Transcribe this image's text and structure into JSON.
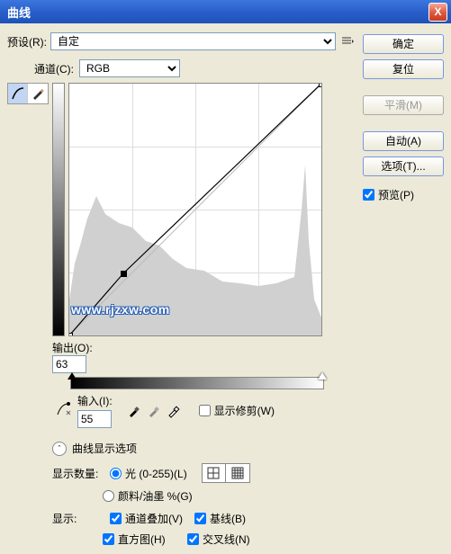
{
  "title": "曲线",
  "close": "X",
  "preset": {
    "label": "预设(R):",
    "value": "自定"
  },
  "channel": {
    "label": "通道(C):",
    "value": "RGB"
  },
  "output": {
    "label": "输出(O):",
    "value": "63"
  },
  "input": {
    "label": "输入(I):",
    "value": "55"
  },
  "showClip": "显示修剪(W)",
  "displayOptions": "曲线显示选项",
  "displayCount": {
    "label": "显示数量:",
    "opt1": "光 (0-255)(L)",
    "opt2": "颜料/油墨 %(G)"
  },
  "show": {
    "label": "显示:",
    "chOverlay": "通道叠加(V)",
    "baseline": "基线(B)",
    "histogram": "直方图(H)",
    "cross": "交叉线(N)"
  },
  "buttons": {
    "ok": "确定",
    "reset": "复位",
    "smooth": "平滑(M)",
    "auto": "自动(A)",
    "options": "选项(T)...",
    "preview": "预览(P)"
  },
  "watermark": "www.rjzxw.com",
  "chart_data": {
    "type": "line",
    "title": "曲线",
    "xlabel": "输入",
    "ylabel": "输出",
    "xlim": [
      0,
      255
    ],
    "ylim": [
      0,
      255
    ],
    "points": [
      {
        "x": 0,
        "y": 0
      },
      {
        "x": 55,
        "y": 63
      },
      {
        "x": 255,
        "y": 255
      }
    ],
    "selected_point": {
      "x": 55,
      "y": 63
    },
    "channel": "RGB"
  }
}
